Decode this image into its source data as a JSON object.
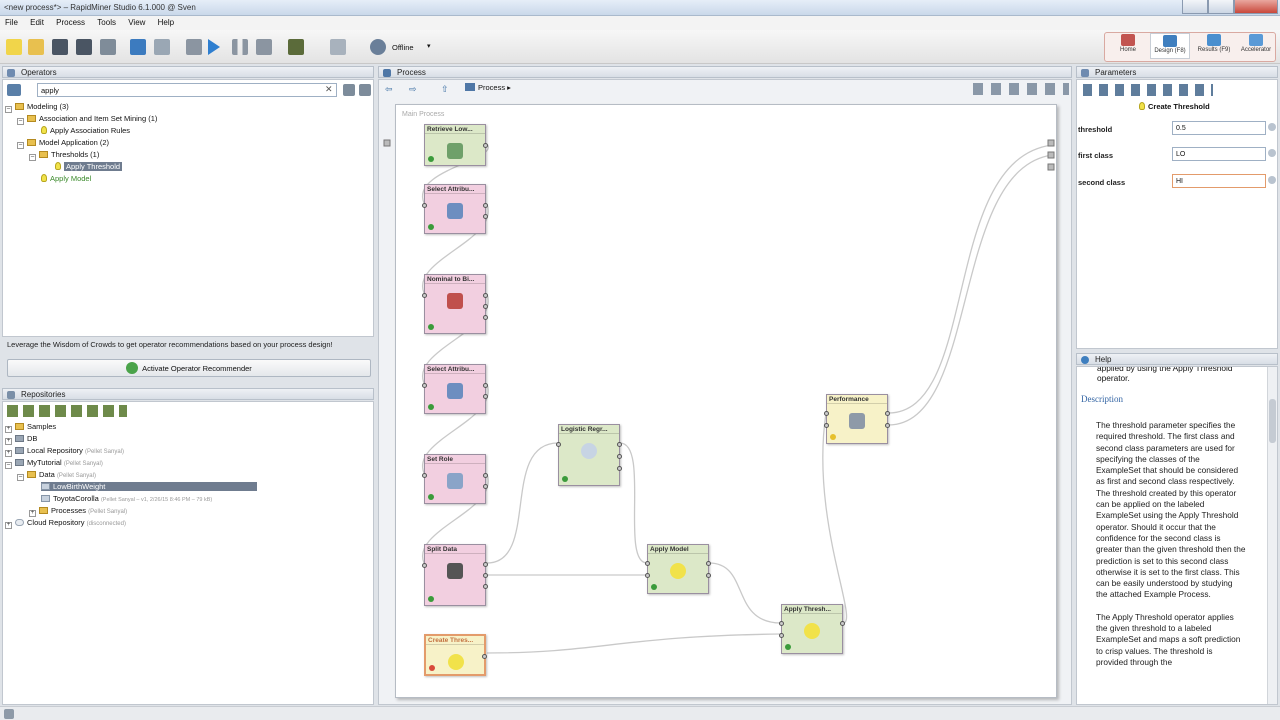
{
  "window": {
    "title": "<new process*> – RapidMiner Studio 6.1.000 @ Sven"
  },
  "menu": [
    "File",
    "Edit",
    "Process",
    "Tools",
    "View",
    "Help"
  ],
  "toolbar": {
    "offline_label": "Offline"
  },
  "perspectives": [
    {
      "label": "Home"
    },
    {
      "label": "Design (F8)"
    },
    {
      "label": "Results (F9)"
    },
    {
      "label": "Accelerator"
    }
  ],
  "operators_panel": {
    "title": "Operators",
    "search_value": "apply",
    "tree": [
      {
        "label": "Modeling (3)",
        "count": ""
      },
      {
        "label": "Association and Item Set Mining (1)"
      },
      {
        "label": "Apply Association Rules"
      },
      {
        "label": "Model Application (2)"
      },
      {
        "label": "Thresholds (1)"
      },
      {
        "label": "Apply Threshold"
      },
      {
        "label": "Apply Model"
      }
    ],
    "recommender_text": "Leverage the Wisdom of Crowds to get operator recommendations based on your process design!",
    "recommender_button": "Activate Operator Recommender"
  },
  "repositories_panel": {
    "title": "Repositories",
    "items": [
      {
        "label": "Samples",
        "note": ""
      },
      {
        "label": "DB",
        "note": ""
      },
      {
        "label": "Local Repository",
        "note": "(Pellet Sanyal)"
      },
      {
        "label": "MyTutorial",
        "note": "(Pellet Sanyal)"
      },
      {
        "label": "Data",
        "note": "(Pellet Sanyal)"
      },
      {
        "label": "LowBirthWeight",
        "note": ""
      },
      {
        "label": "ToyotaCorolla",
        "note": "(Pellet Sanyal – v1, 2/26/15 8:46 PM – 79 kB)"
      },
      {
        "label": "Processes",
        "note": "(Pellet Sanyal)"
      },
      {
        "label": "Cloud Repository",
        "note": "(disconnected)"
      }
    ]
  },
  "process_panel": {
    "title": "Process",
    "breadcrumb": "Process",
    "canvas_label": "Main Process",
    "operators": [
      {
        "title": "Retrieve Low...",
        "ports_out": [
          "out"
        ]
      },
      {
        "title": "Select Attribu...",
        "ports_in": [
          "exa"
        ],
        "ports_out": [
          "exa",
          "ori"
        ]
      },
      {
        "title": "Nominal to Bi...",
        "ports_in": [
          "exa"
        ],
        "ports_out": [
          "exa",
          "ori",
          "pre"
        ]
      },
      {
        "title": "Select Attribu...",
        "ports_in": [
          "exa"
        ],
        "ports_out": [
          "exa",
          "ori"
        ]
      },
      {
        "title": "Set Role",
        "ports_in": [
          "exa"
        ],
        "ports_out": [
          "exa",
          "ori"
        ]
      },
      {
        "title": "Split Data",
        "ports_in": [
          "exa"
        ],
        "ports_out": [
          "par",
          "par",
          "par"
        ]
      },
      {
        "title": "Create Thres...",
        "ports_out": [
          "out"
        ]
      },
      {
        "title": "Logistic Regr...",
        "ports_in": [
          "tra"
        ],
        "ports_out": [
          "mod",
          "exa",
          "wei"
        ]
      },
      {
        "title": "Apply Model",
        "ports_in": [
          "mod",
          "unl"
        ],
        "ports_out": [
          "lab",
          "mod"
        ]
      },
      {
        "title": "Apply Thresh...",
        "ports_in": [
          "exa",
          "thr"
        ],
        "ports_out": [
          "exa"
        ]
      },
      {
        "title": "Performance",
        "ports_in": [
          "lab",
          "per"
        ],
        "ports_out": [
          "per",
          "exa"
        ]
      }
    ]
  },
  "parameters_panel": {
    "title": "Parameters",
    "operator_name": "Create Threshold",
    "params": [
      {
        "label": "threshold",
        "value": "0.5"
      },
      {
        "label": "first class",
        "value": "LO"
      },
      {
        "label": "second class",
        "value": "HI"
      }
    ]
  },
  "help_panel": {
    "title": "Help",
    "intro": "applied by using the Apply Threshold operator.",
    "heading": "Description",
    "body1": "The threshold parameter specifies the required threshold. The first class and second class parameters are used for specifying the classes of the ExampleSet that should be considered as first and second class respectively. The threshold created by this operator can be applied on the labeled ExampleSet using the Apply Threshold operator. Should it occur that the confidence for the second class is greater than the given threshold then the prediction is set to this second class otherwise it is set to the first class. This can be easily understood by studying the attached Example Process.",
    "body2": "The Apply Threshold operator applies the given threshold to a labeled ExampleSet and maps a soft prediction to crisp values. The threshold is provided through the"
  },
  "colors": {
    "pink_op": "#f2cfe0",
    "green_op": "#dce8c8",
    "yellow_op": "#f7f2c8",
    "selection": "#6f7c8f"
  }
}
